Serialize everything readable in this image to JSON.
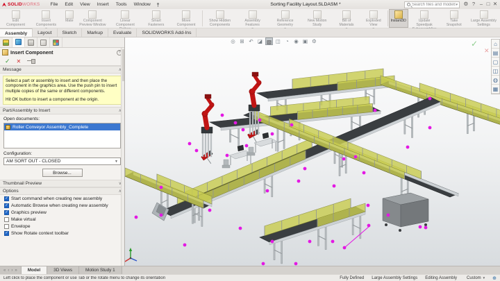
{
  "window": {
    "title": "Sorting Facility Layout.SLDASM *",
    "search_placeholder": "Search files and models",
    "brand_solid": "SOLID",
    "brand_works": "WORKS"
  },
  "menus": [
    "File",
    "Edit",
    "View",
    "Insert",
    "Tools",
    "Window"
  ],
  "commandbar": {
    "buttons": [
      {
        "label": "Edit Component",
        "arrow": false
      },
      {
        "label": "Insert Components",
        "arrow": true
      },
      {
        "label": "Mate",
        "arrow": false
      },
      {
        "label": "Component Preview Window",
        "arrow": false
      },
      {
        "label": "Linear Component Pattern",
        "arrow": true
      },
      {
        "label": "Smart Fasteners",
        "arrow": false
      },
      {
        "label": "Move Component",
        "arrow": true
      },
      {
        "sep": true
      },
      {
        "label": "Show Hidden Components",
        "arrow": false
      },
      {
        "label": "Assembly Features",
        "arrow": true
      },
      {
        "label": "Reference Geometry",
        "arrow": true
      },
      {
        "label": "New Motion Study",
        "arrow": false
      },
      {
        "label": "Bill of Materials",
        "arrow": true
      },
      {
        "label": "Exploded View",
        "arrow": true
      },
      {
        "sep": true
      },
      {
        "label": "Instant3D",
        "arrow": false,
        "active": true
      },
      {
        "label": "Update Speedpak Subassemblies",
        "arrow": false
      },
      {
        "label": "Take Snapshot",
        "arrow": false
      },
      {
        "label": "Large Assembly Settings",
        "arrow": false
      }
    ]
  },
  "ribbon_tabs": [
    {
      "label": "Assembly",
      "active": true
    },
    {
      "label": "Layout"
    },
    {
      "label": "Sketch"
    },
    {
      "label": "Markup"
    },
    {
      "label": "Evaluate"
    },
    {
      "label": "SOLIDWORKS Add-Ins"
    }
  ],
  "pm": {
    "tabs": [
      {
        "name": "featuremanager-tree-tab",
        "cls": "ico-fm"
      },
      {
        "name": "propertymanager-tab",
        "cls": "ico-pm",
        "active": true
      },
      {
        "name": "configurationmanager-tab",
        "cls": "ico-cfg"
      },
      {
        "name": "dimxpertmanager-tab",
        "cls": "ico-dim"
      },
      {
        "name": "displaymanager-tab",
        "cls": "ico-disp"
      }
    ],
    "title": "Insert Component",
    "help": "?",
    "message_header": "Message",
    "message_p1": "Select a part or assembly to insert and then place the component in the graphics area. Use the push pin to insert multiple copies of the same or different components.",
    "message_p2": "Hit OK button to insert a component at the origin.",
    "part_header": "Part/Assembly to Insert",
    "open_documents_label": "Open documents:",
    "document_name": "Roller Conveyor Assembly_Complete",
    "configuration_label": "Configuration:",
    "configuration_value": "AM SORT OUT - CLOSED",
    "browse_label": "Browse...",
    "thumbnail_header": "Thumbnail Preview",
    "options_header": "Options",
    "options": [
      {
        "label": "Start command when creating new assembly",
        "checked": true
      },
      {
        "label": "Automatic Browse when creating new assembly",
        "checked": true
      },
      {
        "label": "Graphics preview",
        "checked": true
      },
      {
        "label": "Make virtual",
        "checked": false
      },
      {
        "label": "Envelope",
        "checked": false
      },
      {
        "label": "Show Rotate context toolbar",
        "checked": true
      }
    ],
    "chevron_up": "∧",
    "chevron_down": "∨"
  },
  "hud_icons": [
    {
      "name": "zoom-to-fit-icon",
      "glyph": "◎"
    },
    {
      "name": "zoom-to-area-icon",
      "glyph": "⊞"
    },
    {
      "name": "previous-view-icon",
      "glyph": "↶"
    },
    {
      "name": "section-view-icon",
      "glyph": "◪"
    },
    {
      "name": "view-orientation-icon",
      "glyph": "▧",
      "active": true
    },
    {
      "name": "display-style-icon",
      "glyph": "◫"
    },
    {
      "name": "hide-show-items-icon",
      "glyph": "◔"
    },
    {
      "name": "edit-appearance-icon",
      "glyph": "◉"
    },
    {
      "name": "apply-scene-icon",
      "glyph": "▣"
    },
    {
      "name": "view-settings-icon",
      "glyph": "⚙"
    }
  ],
  "taskpane_icons": [
    {
      "name": "solidworks-resources-icon",
      "glyph": "⌂"
    },
    {
      "name": "design-library-icon",
      "glyph": "▤"
    },
    {
      "name": "file-explorer-icon",
      "glyph": "▢"
    },
    {
      "name": "view-palette-icon",
      "glyph": "◫"
    },
    {
      "name": "appearances-icon",
      "glyph": "◍"
    },
    {
      "name": "custom-properties-icon",
      "glyph": "▦"
    }
  ],
  "bottom_tabs": [
    {
      "label": "Model",
      "active": true
    },
    {
      "label": "3D Views"
    },
    {
      "label": "Motion Study 1"
    }
  ],
  "statusbar": {
    "hint": "Left click to place the component or use Tab or the rotate menu to change its orientation",
    "items": [
      "Fully Defined",
      "Large Assembly Settings",
      "Editing Assembly"
    ],
    "unit": "Custom"
  },
  "colors": {
    "magenta": "#e318e3",
    "robot_red": "#c01414",
    "robot_dark": "#8c1212",
    "guard_yellow": "#c9cd52",
    "guard_edge": "#84882e",
    "belt_dark": "#3a3e41",
    "frame_gray": "#b7bcbf",
    "steel_light": "#ccd1d4",
    "post_gray": "#8e9396",
    "bin_top": "#9da2a5",
    "bin_front": "#85898c",
    "bin_side": "#74787b",
    "triad_x": "#d03030",
    "triad_y": "#2a9a2a",
    "triad_z": "#2a50c8"
  }
}
